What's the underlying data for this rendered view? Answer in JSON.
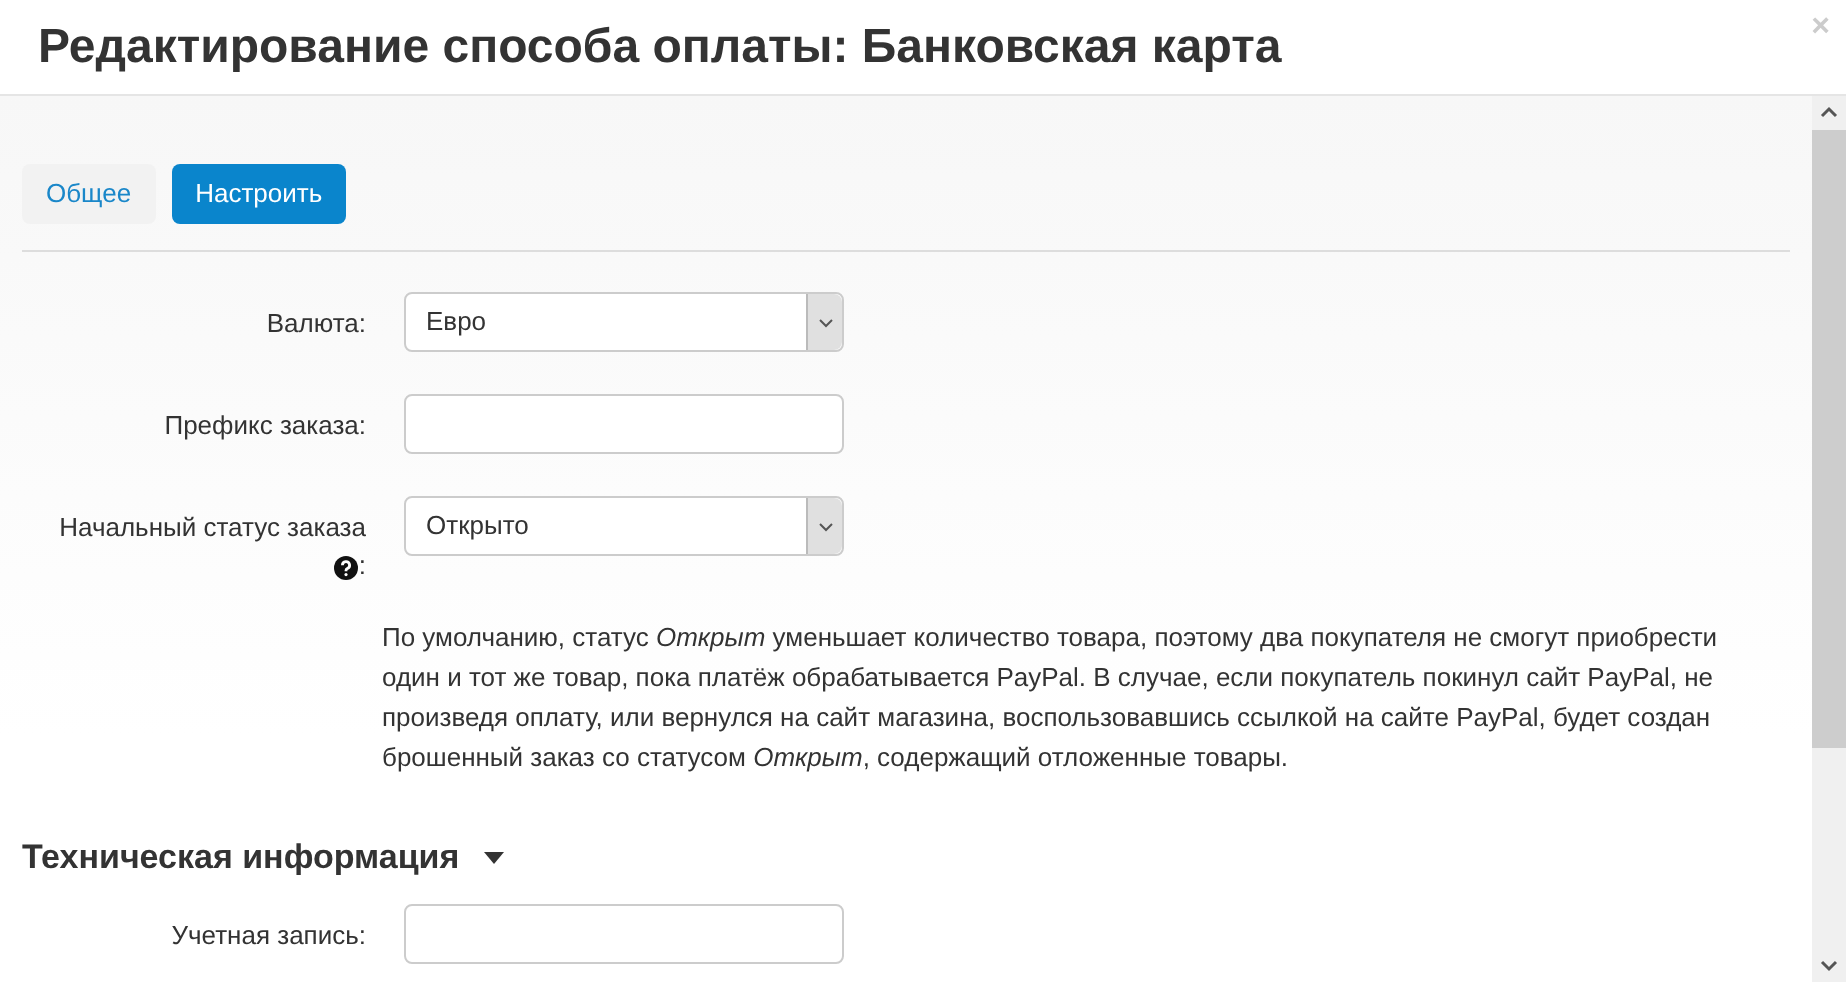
{
  "dialog": {
    "title": "Редактирование способа оплаты: Банковская карта",
    "close": "×"
  },
  "tabs": [
    {
      "label": "Общее",
      "selected": false
    },
    {
      "label": "Настроить",
      "selected": true
    }
  ],
  "fields": [
    {
      "kind": "select",
      "label": "Валюта:",
      "value": "Евро"
    },
    {
      "kind": "text",
      "label": "Префикс заказа:"
    },
    {
      "kind": "select",
      "label": "Начальный статус заказа",
      "help_icon": true,
      "label_suffix": ":",
      "value": "Открыто"
    }
  ],
  "help_text": "По умолчанию, статус *Открыт* уменьшает количество товара, поэтому два покупателя не смогут приобрести один и тот же товар, пока платёж обрабатывается PayPal. В случае, если покупатель покинул сайт PayPal, не произведя оплату, или вернулся на сайт магазина, воспользовавшись ссылкой на сайте PayPal, будет создан брошенный заказ со статусом *Открыт*, содержащий отложенные товары.",
  "section": {
    "title": "Техническая информация",
    "expanded": true,
    "fields": [
      {
        "kind": "text",
        "label": "Учетная запись:"
      }
    ]
  }
}
